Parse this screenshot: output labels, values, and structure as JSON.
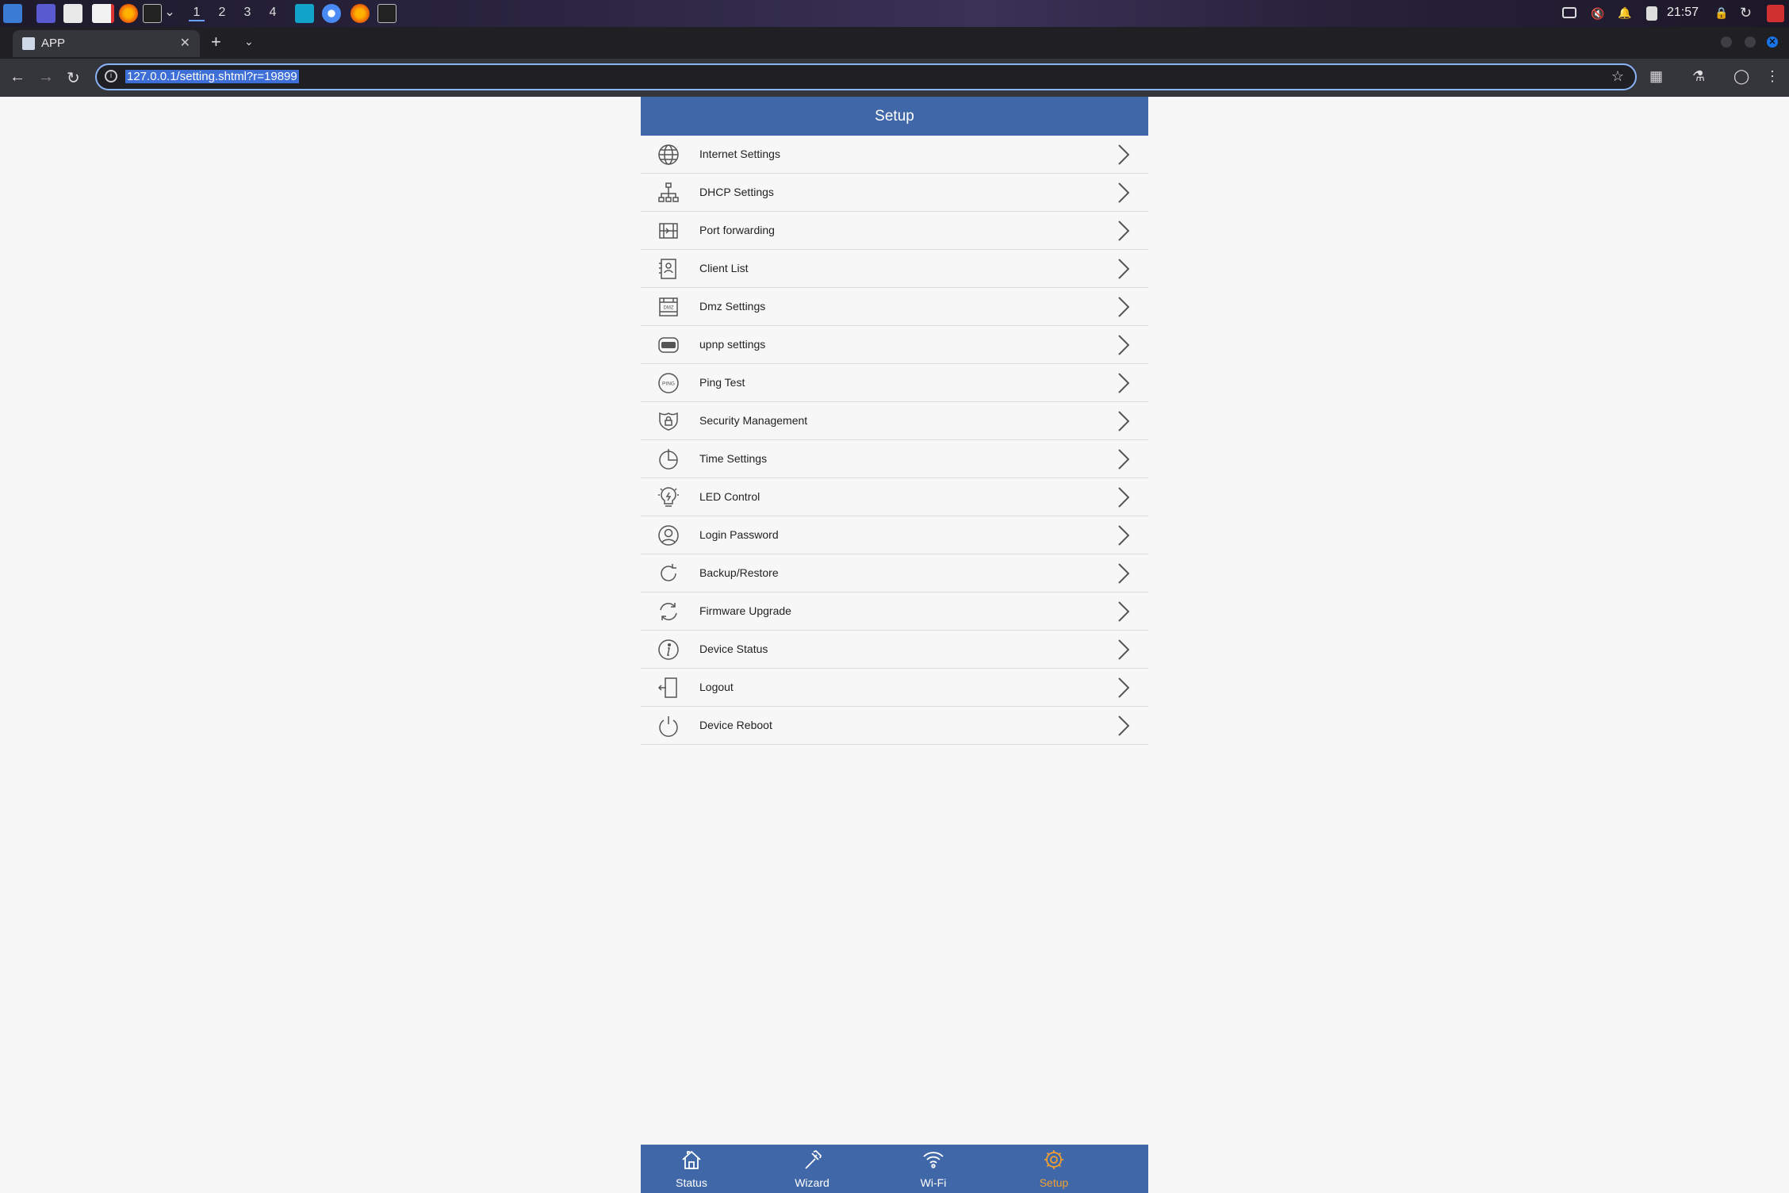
{
  "taskbar": {
    "workspaces": [
      "1",
      "2",
      "3",
      "4"
    ],
    "clock": "21:57",
    "icons": [
      "app-launcher-icon",
      "desktop-icon",
      "file-manager-icon",
      "text-editor-icon",
      "firefox-icon",
      "terminal-icon",
      "bolt-app-icon",
      "chromium-icon",
      "firefox-icon",
      "terminal-icon"
    ]
  },
  "browser": {
    "tab_title": "APP",
    "url": "127.0.0.1/setting.shtml?r=19899"
  },
  "page": {
    "title": "Setup",
    "menu": [
      {
        "label": "Internet Settings",
        "icon": "globe-icon"
      },
      {
        "label": "DHCP Settings",
        "icon": "network-tree-icon"
      },
      {
        "label": "Port forwarding",
        "icon": "port-forward-icon"
      },
      {
        "label": "Client List",
        "icon": "client-list-icon"
      },
      {
        "label": "Dmz Settings",
        "icon": "dmz-icon"
      },
      {
        "label": "upnp settings",
        "icon": "upnp-icon"
      },
      {
        "label": "Ping Test",
        "icon": "ping-icon"
      },
      {
        "label": "Security Management",
        "icon": "shield-lock-icon"
      },
      {
        "label": "Time Settings",
        "icon": "clock-pie-icon"
      },
      {
        "label": "LED Control",
        "icon": "bulb-icon"
      },
      {
        "label": "Login Password",
        "icon": "user-icon"
      },
      {
        "label": "Backup/Restore",
        "icon": "backup-icon"
      },
      {
        "label": "Firmware Upgrade",
        "icon": "sync-icon"
      },
      {
        "label": "Device Status",
        "icon": "info-icon"
      },
      {
        "label": "Logout",
        "icon": "logout-icon"
      },
      {
        "label": "Device Reboot",
        "icon": "power-icon"
      }
    ],
    "bottom_nav": [
      {
        "label": "Status",
        "icon": "home-icon",
        "active": false
      },
      {
        "label": "Wizard",
        "icon": "wand-icon",
        "active": false
      },
      {
        "label": "Wi-Fi",
        "icon": "wifi-icon",
        "active": false
      },
      {
        "label": "Setup",
        "icon": "gear-icon",
        "active": true
      }
    ]
  },
  "colors": {
    "header_bg": "#4068a8",
    "active_nav": "#f0a030",
    "page_bg": "#f7f7f7"
  }
}
